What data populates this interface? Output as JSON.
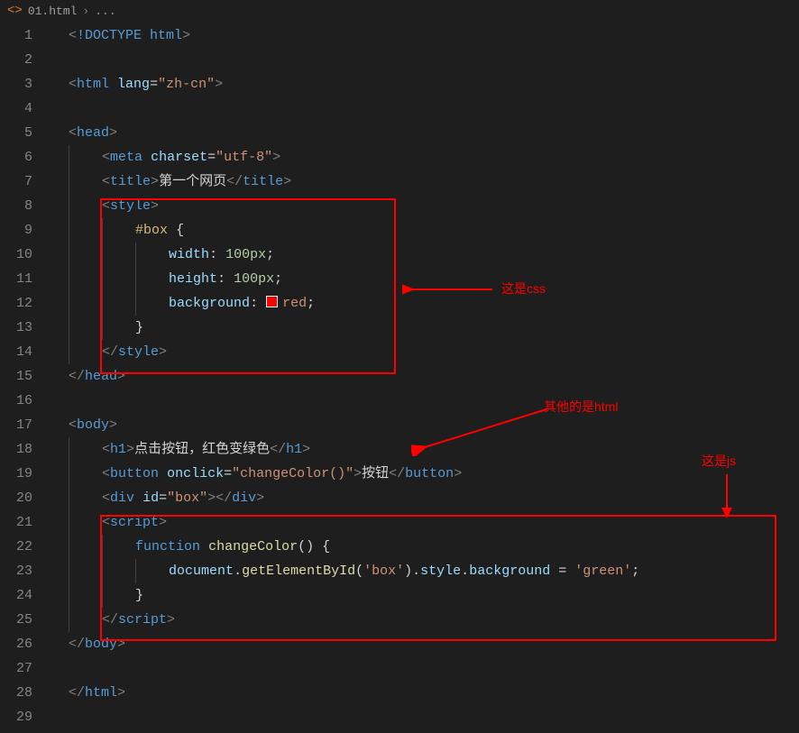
{
  "breadcrumb": {
    "filename": "01.html",
    "rest": "..."
  },
  "annotations": {
    "css_label": "这是css",
    "html_label": "其他的是html",
    "js_label": "这是js"
  },
  "code": {
    "doctype_kw": "!DOCTYPE",
    "doctype_val": "html",
    "html_tag": "html",
    "lang_attr": "lang",
    "lang_val": "\"zh-cn\"",
    "head_tag": "head",
    "meta_tag": "meta",
    "charset_attr": "charset",
    "charset_val": "\"utf-8\"",
    "title_tag": "title",
    "title_text": "第一个网页",
    "style_tag": "style",
    "css_selector": "#box",
    "css_brace_open": "{",
    "css_brace_close": "}",
    "css_width_prop": "width",
    "css_width_val": "100px",
    "css_height_prop": "height",
    "css_height_val": "100px",
    "css_bg_prop": "background",
    "css_bg_val": "red",
    "body_tag": "body",
    "h1_tag": "h1",
    "h1_text": "点击按钮，红色变绿色",
    "button_tag": "button",
    "onclick_attr": "onclick",
    "onclick_val": "\"changeColor()\"",
    "button_text": "按钮",
    "div_tag": "div",
    "id_attr": "id",
    "id_val": "\"box\"",
    "script_tag": "script",
    "fn_kw": "function",
    "fn_name": "changeColor",
    "doc_obj": "document",
    "method": "getElementById",
    "arg": "'box'",
    "style_prop": "style",
    "bg_prop2": "background",
    "green_val": "'green'"
  },
  "line_numbers": [
    "1",
    "2",
    "3",
    "4",
    "5",
    "6",
    "7",
    "8",
    "9",
    "10",
    "11",
    "12",
    "13",
    "14",
    "15",
    "16",
    "17",
    "18",
    "19",
    "20",
    "21",
    "22",
    "23",
    "24",
    "25",
    "26",
    "27",
    "28",
    "29"
  ]
}
